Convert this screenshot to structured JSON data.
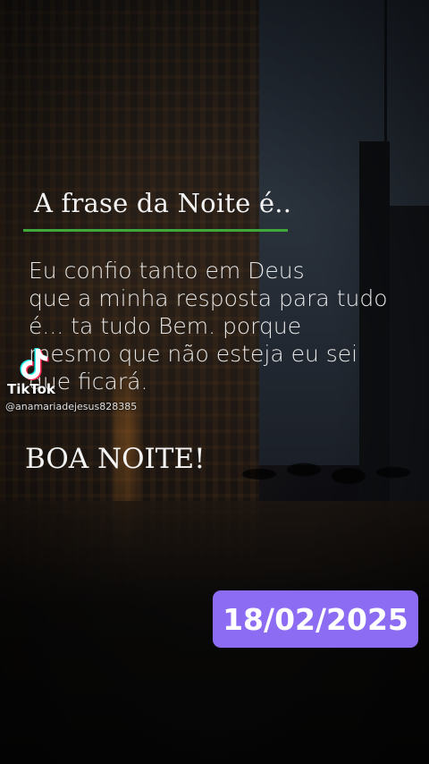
{
  "overlay": {
    "title": "A frase da Noite é..",
    "body": "Eu confio tanto em Deus\nque a minha resposta para tudo\né... ta tudo Bem. porque\nmesmo que não esteja eu sei\nque ficará.",
    "greeting": "BOA NOITE!",
    "date": "18/02/2025",
    "accent_line_color": "#3fa83a",
    "date_badge_color": "#8b6cf2"
  },
  "watermark": {
    "app": "TikTok",
    "username": "@anamariadejesus828385",
    "icon": "tiktok-logo-icon"
  }
}
